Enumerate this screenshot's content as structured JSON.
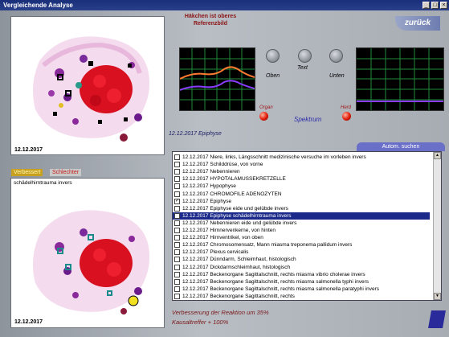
{
  "window": {
    "title": "Vergleichende Analyse",
    "btn_min": "_",
    "btn_max": "□",
    "btn_close": "×"
  },
  "ref_heading": "Häkchen ist oberes Referenzbild",
  "back_label": "zurück",
  "top_panel": {
    "date": "12.12.2017"
  },
  "tabs": {
    "improved": "Verbessert",
    "worse": "Schlechter"
  },
  "bottom_panel": {
    "caption": "schädelhirntrauma invers",
    "date": "12.12.2017"
  },
  "controls": {
    "top": "Oben",
    "text": "Text",
    "bottom": "Unten",
    "organ": "Organ",
    "herd": "Herd",
    "spectrum": "Spektrum"
  },
  "selected_info": "12.12.2017 Epiphyse",
  "auto_search": "Autom. suchen",
  "list": {
    "items": [
      {
        "date": "12.12.2017",
        "text": "Niere, links, Längsschnitt  medizinische versuche im vorleben invers",
        "checked": false,
        "selected": false
      },
      {
        "date": "12.12.2017",
        "text": "Schilddrüse, von vorne",
        "checked": false,
        "selected": false
      },
      {
        "date": "12.12.2017",
        "text": "Nebennieren",
        "checked": false,
        "selected": false
      },
      {
        "date": "12.12.2017",
        "text": "HYPOTALAMUSSEKRETZELLE",
        "checked": false,
        "selected": false
      },
      {
        "date": "12.12.2017",
        "text": "Hypophyse",
        "checked": false,
        "selected": false
      },
      {
        "date": "12.12.2017",
        "text": "CHROMOFILE ADENOZYTEN",
        "checked": false,
        "selected": false
      },
      {
        "date": "12.12.2017",
        "text": "Epiphyse",
        "checked": true,
        "selected": false
      },
      {
        "date": "12.12.2017",
        "text": "Epiphyse  eide und gelübde invers",
        "checked": false,
        "selected": false
      },
      {
        "date": "12.12.2017",
        "text": "Epiphyse  schädelhirntrauma invers",
        "checked": false,
        "selected": true
      },
      {
        "date": "12.12.2017",
        "text": "Nebennieren  eide und gelübde invers",
        "checked": false,
        "selected": false
      },
      {
        "date": "12.12.2017",
        "text": "Hirnnervenkerne, von hinten",
        "checked": false,
        "selected": false
      },
      {
        "date": "12.12.2017",
        "text": "Hirnventrikel, von oben",
        "checked": false,
        "selected": false
      },
      {
        "date": "12.12.2017",
        "text": "Chromosomensatz, Mann  miasma treponema pallidum invers",
        "checked": false,
        "selected": false
      },
      {
        "date": "12.12.2017",
        "text": "Plexus cervicalis",
        "checked": false,
        "selected": false
      },
      {
        "date": "12.12.2017",
        "text": "Dünndarm, Schleimhaut, histologisch",
        "checked": false,
        "selected": false
      },
      {
        "date": "12.12.2017",
        "text": "Dickdarmschleimhaut, histologisch",
        "checked": false,
        "selected": false
      },
      {
        "date": "12.12.2017",
        "text": "Beckenorgane Sagittalschnitt, rechts  miasma vibrio cholerae invers",
        "checked": false,
        "selected": false
      },
      {
        "date": "12.12.2017",
        "text": "Beckenorgane Sagittalschnitt, rechts  miasma salmonella typhi invers",
        "checked": false,
        "selected": false
      },
      {
        "date": "12.12.2017",
        "text": "Beckenorgane Sagittalschnitt, rechts  miasma salmonella paratyphi invers",
        "checked": false,
        "selected": false
      },
      {
        "date": "12.12.2017",
        "text": "Beckenorgane Sagittalschnitt, rechts",
        "checked": false,
        "selected": false
      }
    ]
  },
  "status": {
    "line1": "Verbesserung der Reaktion um 35%",
    "line2": "Kausaltreffer + 100%"
  },
  "colors": {
    "accent": "#6a70c8",
    "selection": "#1b2a8a",
    "status_text": "#7a1818",
    "signal_orange": "#ff7a30",
    "signal_purple": "#8a3cff",
    "scope_grid": "#1f8a3a"
  }
}
